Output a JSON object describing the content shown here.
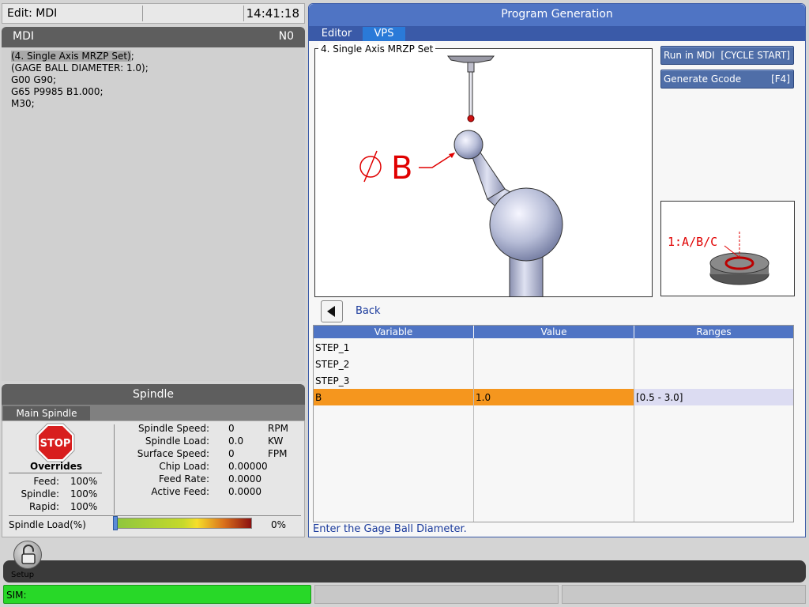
{
  "topbar": {
    "mode": "Edit: MDI",
    "time": "14:41:18"
  },
  "mdi": {
    "title": "MDI",
    "line_number": "N0",
    "lines": [
      "(4. Single Axis MRZP Set)",
      ";",
      "(GAGE BALL DIAMETER: 1.0);",
      "G00 G90;",
      "G65 P9985 B1.000;",
      "M30;"
    ]
  },
  "spindle": {
    "title": "Spindle",
    "tab": "Main Spindle",
    "stop_label": "STOP",
    "overrides_title": "Overrides",
    "overrides": [
      {
        "label": "Feed:",
        "value": "100%"
      },
      {
        "label": "Spindle:",
        "value": "100%"
      },
      {
        "label": "Rapid:",
        "value": "100%"
      }
    ],
    "stats": [
      {
        "label": "Spindle Speed:",
        "value": "0",
        "unit": "RPM"
      },
      {
        "label": "Spindle Load:",
        "value": "0.0",
        "unit": "KW"
      },
      {
        "label": "Surface Speed:",
        "value": "0",
        "unit": "FPM"
      },
      {
        "label": "Chip Load:",
        "value": "0.00000",
        "unit": ""
      },
      {
        "label": "Feed Rate:",
        "value": "0.0000",
        "unit": ""
      },
      {
        "label": "Active Feed:",
        "value": "0.0000",
        "unit": ""
      }
    ],
    "load_label": "Spindle Load(%)",
    "load_value": "0%"
  },
  "program_generation": {
    "title": "Program Generation",
    "tabs": [
      "Editor",
      "VPS"
    ],
    "active_tab": "VPS",
    "figure_title": "4. Single Axis MRZP Set",
    "figure_label": "B",
    "run_button": {
      "left": "Run in MDI",
      "right": "[CYCLE START]"
    },
    "gen_button": {
      "left": "Generate Gcode",
      "right": "[F4]"
    },
    "thumb_label": "1:A/B/C",
    "back_label": "Back",
    "table": {
      "headers": [
        "Variable",
        "Value",
        "Ranges"
      ],
      "rows": [
        {
          "variable": "STEP_1",
          "value": "",
          "range": ""
        },
        {
          "variable": "STEP_2",
          "value": "",
          "range": ""
        },
        {
          "variable": "STEP_3",
          "value": "",
          "range": ""
        },
        {
          "variable": "B",
          "value": "1.0",
          "range": "[0.5 - 3.0]"
        }
      ]
    },
    "hint": "Enter the Gage Ball Diameter."
  },
  "bottom": {
    "setup_label": "Setup",
    "status_text": "SIM:"
  },
  "colors": {
    "header_blue": "#4f74c4",
    "selected_orange": "#f5961e",
    "status_green": "#28d828",
    "figure_red": "#e00000"
  }
}
